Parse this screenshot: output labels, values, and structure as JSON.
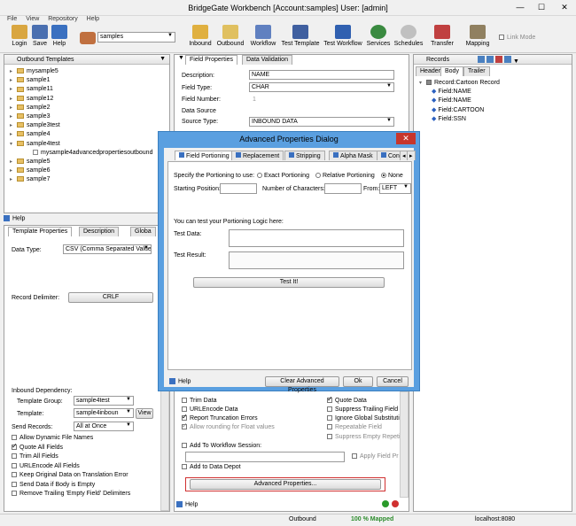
{
  "window": {
    "title": "BridgeGate Workbench [Account:samples] User: [admin]",
    "minimize": "—",
    "maximize": "☐",
    "close": "✕"
  },
  "menu": [
    "File",
    "View",
    "Repository",
    "Help"
  ],
  "toolbar": {
    "login": "Login",
    "save": "Save",
    "help": "Help",
    "account": "samples",
    "inbound": "Inbound",
    "outbound": "Outbound",
    "workflow": "Workflow",
    "test_template": "Test Template",
    "test_workflow": "Test Workflow",
    "services": "Services",
    "schedules": "Schedules",
    "transfer": "Transfer",
    "mapping": "Mapping",
    "link_mode": "Link Mode"
  },
  "outbound": {
    "title": "Outbound Templates",
    "items": [
      "mysample5",
      "sample1",
      "sample11",
      "sample12",
      "sample2",
      "sample3",
      "sample3test",
      "sample4",
      "sample4test",
      "mysample4advancedpropertiesoutbound",
      "sample5",
      "sample6",
      "sample7"
    ]
  },
  "help_bar": {
    "label": "Help"
  },
  "props_tabs": [
    "Template Properties",
    "Description",
    "Globa"
  ],
  "props": {
    "data_type_label": "Data Type:",
    "data_type_value": "CSV (Comma Separated Value",
    "record_delim_label": "Record Delimiter:",
    "record_delim_value": "CRLF",
    "inbound_dep_label": "Inbound Dependency:",
    "template_group_label": "Template Group:",
    "template_group_value": "sample4test",
    "template_label": "Template:",
    "template_value": "sample4inboun",
    "view_label": "View",
    "send_records_label": "Send Records:",
    "send_records_value": "All at Once",
    "checks": [
      {
        "label": "Allow Dynamic File Names",
        "checked": false
      },
      {
        "label": "Quote All Fields",
        "checked": true
      },
      {
        "label": "Trim All Fields",
        "checked": false
      },
      {
        "label": "URLEncode All Fields",
        "checked": false
      },
      {
        "label": "Keep Original Data on Translation Error",
        "checked": false
      },
      {
        "label": "Send Data if Body is Empty",
        "checked": false
      },
      {
        "label": "Remove Trailing 'Empty Field' Delimiters",
        "checked": false
      }
    ]
  },
  "center_tabs": [
    "Field Properties",
    "Data Validation"
  ],
  "center": {
    "description_label": "Description:",
    "description_value": "NAME",
    "field_type_label": "Field Type:",
    "field_type_value": "CHAR",
    "field_number_label": "Field Number:",
    "field_number_value": "1",
    "data_source_label": "Data Source",
    "source_type_label": "Source Type:",
    "source_type_value": "INBOUND DATA",
    "trim_data": "Trim Data",
    "quote_data": "Quote Data",
    "urlencode_data": "URLEncode Data",
    "suppress_trailing": "Suppress Trailing Field D",
    "report_trunc": "Report Truncation Errors",
    "ignore_global": "Ignore Global Substitutio",
    "allow_rounding": "Allow rounding for Float values",
    "repeatable": "Repeatable Field",
    "suppress_empty": "Suppress Empty Repetitic",
    "add_workflow": "Add To Workflow Session:",
    "apply_field": "Apply Field Pr",
    "add_data_depot": "Add to Data Depot",
    "advanced_btn": "Advanced Properties...",
    "help": "Help"
  },
  "records": {
    "title": "Records",
    "tabs": [
      "Header",
      "Body",
      "Trailer"
    ],
    "root": "Record:Cartoon Record",
    "fields": [
      "Field:NAME",
      "Field:NAME",
      "Field:CARTOON",
      "Field:SSN"
    ]
  },
  "dialog": {
    "title": "Advanced Properties Dialog",
    "tabs": [
      "Field Portioning",
      "Replacement",
      "Stripping",
      "Alpha Mask",
      "Con"
    ],
    "specify_label": "Specify the Portioning to use:",
    "exact": "Exact Portioning",
    "relative": "Relative Portioning",
    "none": "None",
    "start_label": "Starting Position:",
    "num_chars_label": "Number of Characters:",
    "from_label": "From:",
    "from_value": "LEFT",
    "test_intro": "You can test your Portioning Logic here:",
    "test_data_label": "Test Data:",
    "test_result_label": "Test Result:",
    "test_btn": "Test It!",
    "help": "Help",
    "clear_btn": "Clear Advanced Properties",
    "ok_btn": "Ok",
    "cancel_btn": "Cancel"
  },
  "status": {
    "outbound": "Outbound",
    "mapped": "100 % Mapped",
    "host": "localhost:8080"
  },
  "colors": {
    "dialog_frame": "#5a9fe0",
    "close_red": "#c7362c",
    "mapped_green": "#2a8a2a",
    "highlight_red": "#d03030"
  }
}
